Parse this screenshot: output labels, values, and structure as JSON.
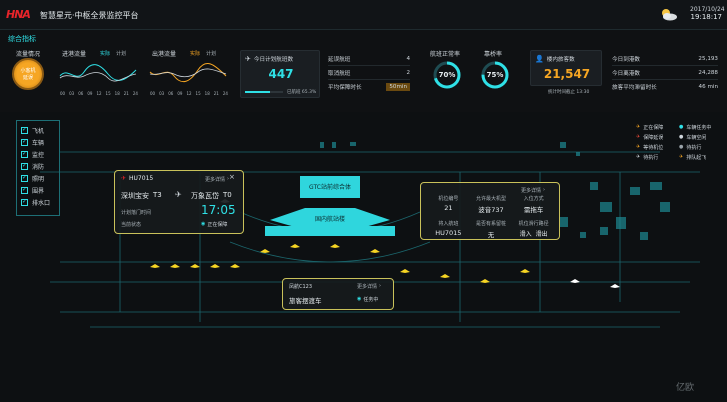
{
  "header": {
    "logo_text": "HNA",
    "title": "智慧星元·中枢全景监控平台",
    "weather_icon": "sun-cloud-icon",
    "date": "2017/10/24",
    "time": "19:18:17"
  },
  "overview": {
    "section_title": "综合指标",
    "traffic": {
      "label": "流量情况",
      "badge_line1": "小客机",
      "badge_line2": "延误"
    },
    "inbound": {
      "label": "进港流量",
      "legend_actual": "实际",
      "legend_plan": "计划"
    },
    "outbound": {
      "label": "出港流量",
      "legend_actual": "实际",
      "legend_plan": "计划"
    },
    "chart_ticks": [
      "00",
      "03",
      "06",
      "09",
      "12",
      "15",
      "18",
      "21",
      "24"
    ],
    "flights": {
      "today_label": "今日计划航班数",
      "today_value": "447",
      "progress_label": "已航班 65.3%",
      "progress": 0.653,
      "delayed_label": "延误航班",
      "delayed_value": "4",
      "cancelled_label": "取消航班",
      "cancelled_value": "2",
      "avg_label": "平均保障时长",
      "avg_value": "50min"
    },
    "on_time": {
      "label": "航班正常率",
      "value": "70%",
      "ratio": 0.7
    },
    "bridge": {
      "label": "靠桥率",
      "value": "75%",
      "ratio": 0.75
    },
    "passengers": {
      "label": "楼内旅客数",
      "value": "21,547",
      "note": "统计时间截止 13:30",
      "arrive_label": "今日到港数",
      "arrive_value": "25,193",
      "depart_label": "今日离港数",
      "depart_value": "24,288",
      "stay_label": "旅客平均滞留时长",
      "stay_value": "46 min"
    }
  },
  "layers": [
    {
      "label": "飞机"
    },
    {
      "label": "车辆"
    },
    {
      "label": "监控"
    },
    {
      "label": "消防"
    },
    {
      "label": "照明"
    },
    {
      "label": "围界"
    },
    {
      "label": "排水口"
    }
  ],
  "legend": [
    {
      "label": "正在保障",
      "color": "#f6a623"
    },
    {
      "label": "车辆任务中",
      "color": "#2fe0e6"
    },
    {
      "label": "保障延误",
      "color": "#e84a3a"
    },
    {
      "label": "车辆空闲",
      "color": "#cfd6dc"
    },
    {
      "label": "等待机位",
      "color": "#f6a623"
    },
    {
      "label": "待执行",
      "color": "#9aa3a9"
    },
    {
      "label": "待执行",
      "color": "#cfd6dc"
    },
    {
      "label": "排队起飞",
      "color": "#f6a623"
    }
  ],
  "map_labels": {
    "gtc": "GTC站前综合体",
    "terminal": "国内航站楼"
  },
  "flight_popup": {
    "flight": "HU7015",
    "detail": "更多详情",
    "origin": "深圳宝安",
    "origin_terminal": "T3",
    "dest": "万象瓦岱",
    "dest_terminal": "T0",
    "plan_label": "计划落门时间",
    "eta": "17:05",
    "status_label": "当前状态",
    "status": "正在保障"
  },
  "stand_popup": {
    "detail": "更多详情",
    "stand_no_label": "机位编号",
    "stand_no": "21",
    "allowed_label": "允许最大机型",
    "allowed": "波音737",
    "entry_label": "入位方式",
    "entry": "需拖车",
    "flight_label": "将入航班",
    "flight": "HU7015",
    "bridge_label": "是否有系留桩",
    "bridge": "无",
    "route_label": "机位滑行路径",
    "route_in": "滑入",
    "route_out": "滑出"
  },
  "vehicle_popup": {
    "id": "凤航C123",
    "detail": "更多详情",
    "type": "旅客摆渡车",
    "status": "任务中"
  },
  "watermark": "亿欧"
}
